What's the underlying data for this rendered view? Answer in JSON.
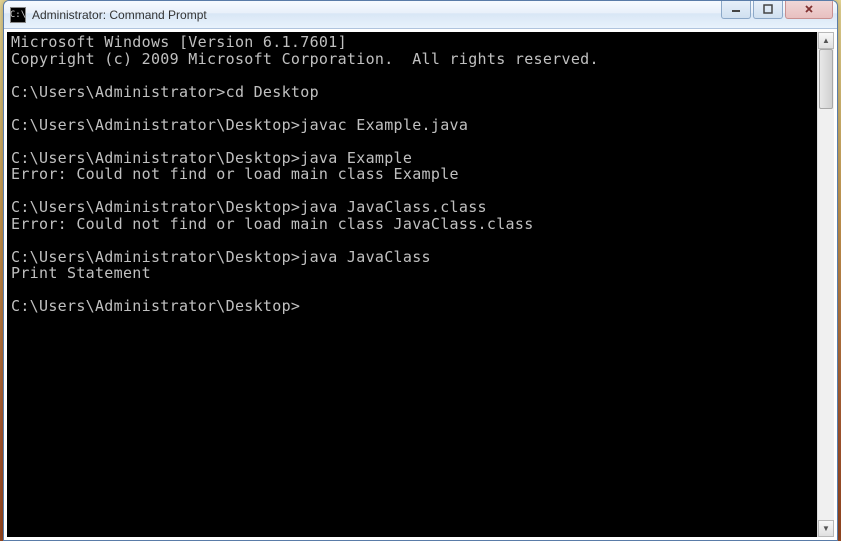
{
  "window": {
    "title": "Administrator: Command Prompt",
    "icon_label": "C:\\"
  },
  "console": {
    "lines": [
      {
        "type": "text",
        "content": "Microsoft Windows [Version 6.1.7601]"
      },
      {
        "type": "text",
        "content": "Copyright (c) 2009 Microsoft Corporation.  All rights reserved."
      },
      {
        "type": "blank"
      },
      {
        "type": "prompt",
        "prompt": "C:\\Users\\Administrator>",
        "command": "cd Desktop"
      },
      {
        "type": "blank"
      },
      {
        "type": "prompt",
        "prompt": "C:\\Users\\Administrator\\Desktop>",
        "command": "javac Example.java"
      },
      {
        "type": "blank"
      },
      {
        "type": "prompt",
        "prompt": "C:\\Users\\Administrator\\Desktop>",
        "command": "java Example"
      },
      {
        "type": "text",
        "content": "Error: Could not find or load main class Example"
      },
      {
        "type": "blank"
      },
      {
        "type": "prompt",
        "prompt": "C:\\Users\\Administrator\\Desktop>",
        "command": "java JavaClass.class"
      },
      {
        "type": "text",
        "content": "Error: Could not find or load main class JavaClass.class"
      },
      {
        "type": "blank"
      },
      {
        "type": "prompt",
        "prompt": "C:\\Users\\Administrator\\Desktop>",
        "command": "java JavaClass"
      },
      {
        "type": "text",
        "content": "Print Statement"
      },
      {
        "type": "blank"
      },
      {
        "type": "prompt",
        "prompt": "C:\\Users\\Administrator\\Desktop>",
        "command": ""
      }
    ]
  }
}
